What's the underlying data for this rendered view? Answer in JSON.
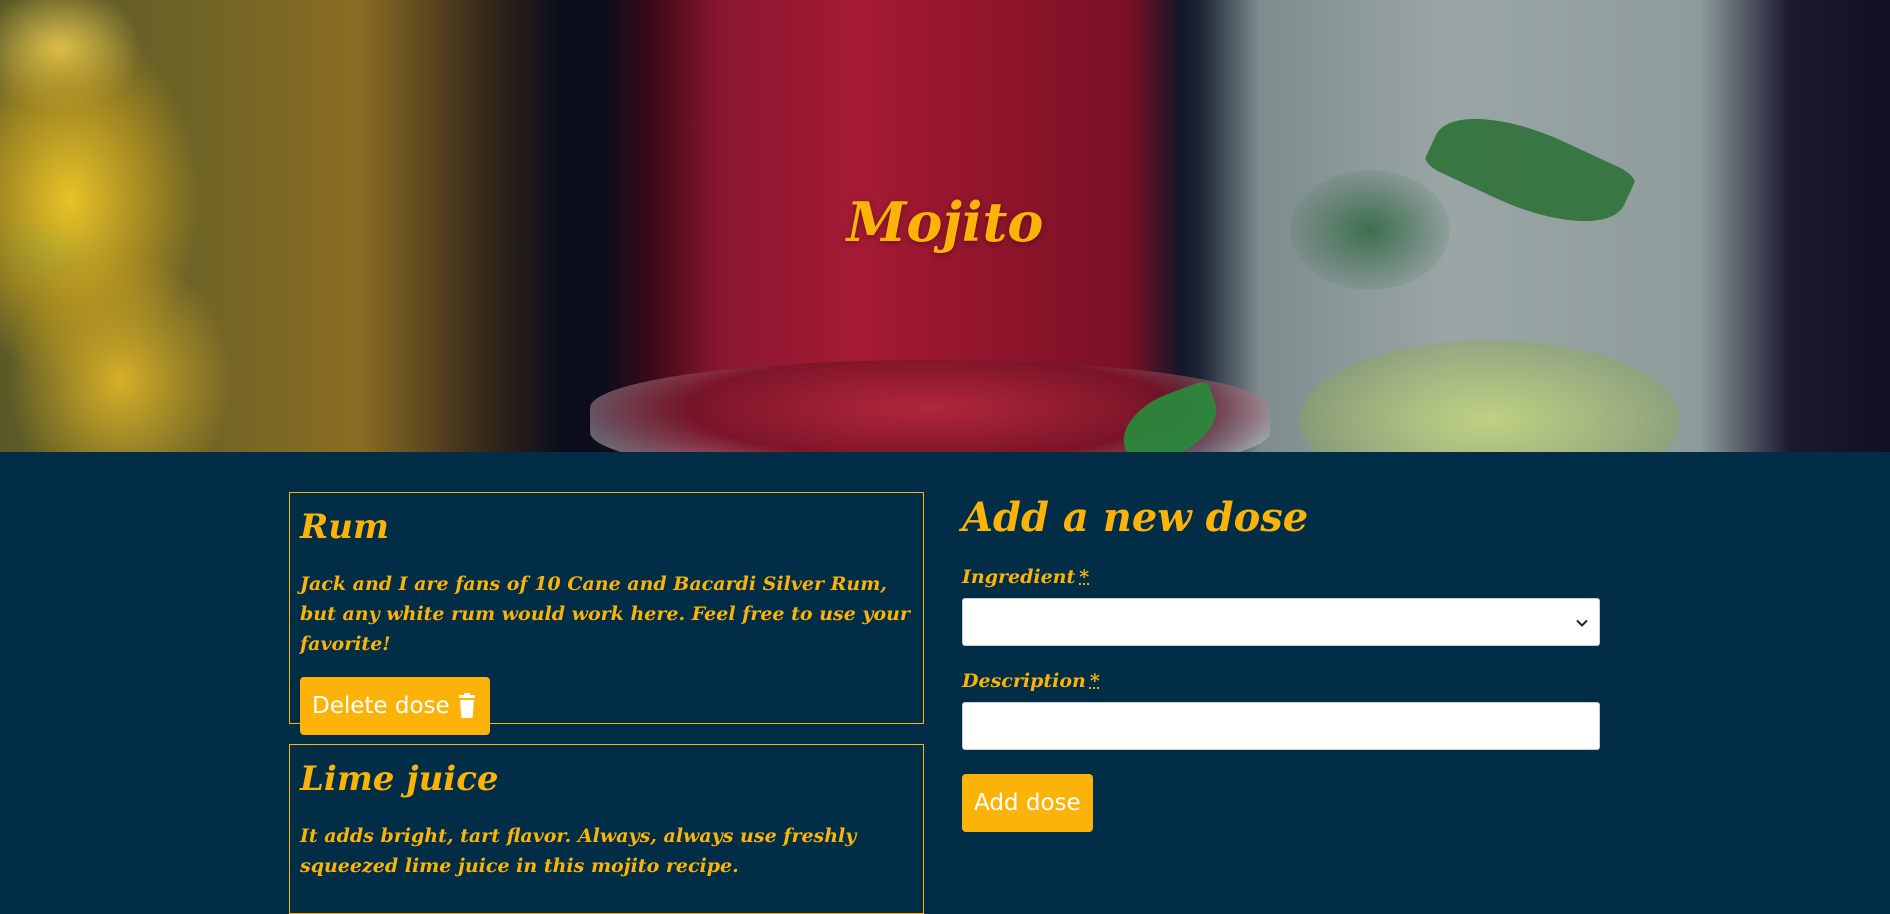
{
  "hero": {
    "title": "Mojito"
  },
  "doses": [
    {
      "name": "Rum",
      "description": "Jack and I are fans of 10 Cane and Bacardi Silver Rum, but any white rum would work here. Feel free to use your favorite!",
      "delete_label": "Delete dose"
    },
    {
      "name": "Lime juice",
      "description": "It adds bright, tart flavor. Always, always use freshly squeezed lime juice in this mojito recipe."
    }
  ],
  "form": {
    "title": "Add a new dose",
    "ingredient_label": "Ingredient",
    "description_label": "Description",
    "required_mark": "*",
    "ingredient_value": "",
    "description_value": "",
    "submit_label": "Add dose"
  },
  "icons": {
    "delete": "trash-icon",
    "select": "chevron-down-icon"
  },
  "colors": {
    "accent": "#fbb309",
    "background": "#012d46",
    "button_text": "#ffffff"
  }
}
